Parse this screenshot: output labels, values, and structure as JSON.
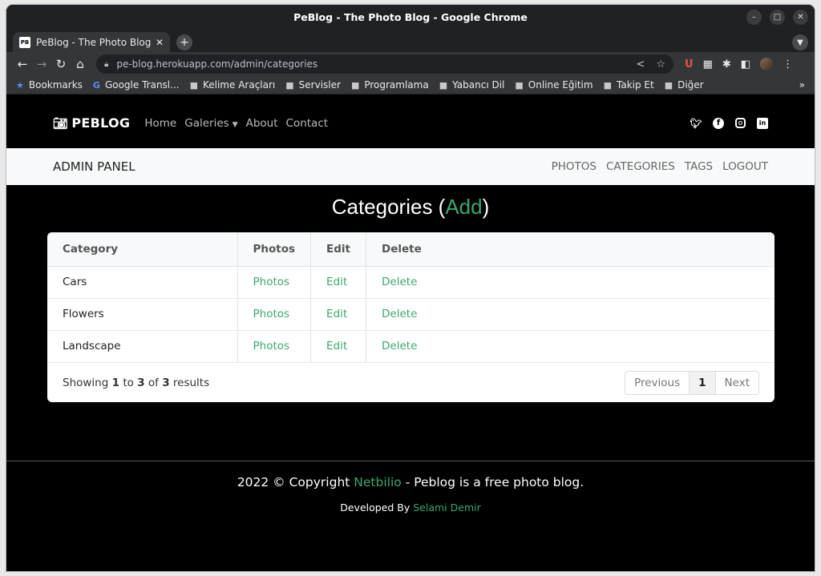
{
  "window": {
    "title": "PeBlog - The Photo Blog - Google Chrome"
  },
  "tab": {
    "title": "PeBlog - The Photo Blog",
    "favicon": "PB"
  },
  "address": {
    "url": "pe-blog.herokuapp.com/admin/categories"
  },
  "bookmarks": [
    "Bookmarks",
    "Google Transl...",
    "Kelime Araçları",
    "Servisler",
    "Programlama",
    "Yabancı Dil",
    "Online Eğitim",
    "Takip Et",
    "Diğer"
  ],
  "site": {
    "brand": "PEBLOG",
    "nav": {
      "home": "Home",
      "galeries": "Galeries",
      "about": "About",
      "contact": "Contact"
    }
  },
  "admin": {
    "title": "ADMIN PANEL",
    "links": {
      "photos": "PHOTOS",
      "categories": "CATEGORIES",
      "tags": "TAGS",
      "logout": "LOGOUT"
    }
  },
  "heading": {
    "prefix": "Categories (",
    "add": "Add",
    "suffix": ")"
  },
  "table": {
    "headers": {
      "category": "Category",
      "photos": "Photos",
      "edit": "Edit",
      "delete": "Delete"
    },
    "rows": [
      {
        "category": "Cars",
        "photos": "Photos",
        "edit": "Edit",
        "delete": "Delete"
      },
      {
        "category": "Flowers",
        "photos": "Photos",
        "edit": "Edit",
        "delete": "Delete"
      },
      {
        "category": "Landscape",
        "photos": "Photos",
        "edit": "Edit",
        "delete": "Delete"
      }
    ]
  },
  "results": {
    "showing": "Showing",
    "from": "1",
    "to_word": "to",
    "to": "3",
    "of_word": "of",
    "total": "3",
    "results_word": "results"
  },
  "pagination": {
    "previous": "Previous",
    "page": "1",
    "next": "Next"
  },
  "footer": {
    "copy_prefix": "2022 © Copyright",
    "company": "Netbilio",
    "copy_suffix": "- Peblog is a free photo blog.",
    "dev_prefix": "Developed By",
    "developer": "Selami Demir"
  },
  "colors": {
    "accent": "#3aa86f",
    "navbar": "#000000",
    "adminbar": "#f8f9fa"
  }
}
